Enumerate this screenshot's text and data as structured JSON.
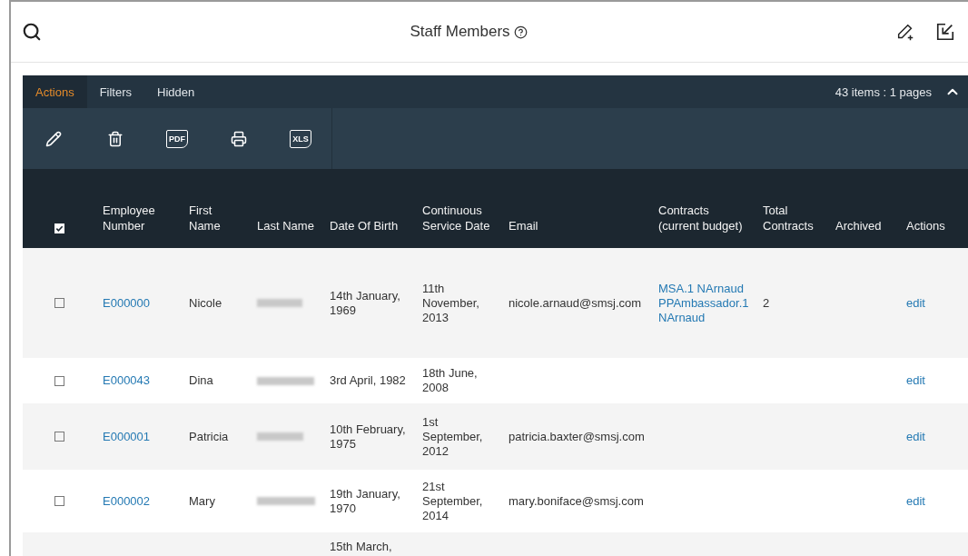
{
  "window": {
    "title": "Staff Members"
  },
  "tabs": [
    {
      "label": "Actions",
      "selected": true
    },
    {
      "label": "Filters",
      "selected": false
    },
    {
      "label": "Hidden",
      "selected": false
    }
  ],
  "pagination": {
    "summary": "43 items : 1 pages",
    "expanded": true
  },
  "toolbar": [
    {
      "kind": "edit"
    },
    {
      "kind": "delete"
    },
    {
      "kind": "file",
      "label": "PDF"
    },
    {
      "kind": "print"
    },
    {
      "kind": "file",
      "label": "XLS"
    }
  ],
  "table": {
    "select_all": {
      "checked": true
    },
    "columns": [
      "Employee Number",
      "First Name",
      "Last Name",
      "Date Of Birth",
      "Continuous Service Date",
      "Email",
      "Contracts (current budget)",
      "Total Contracts",
      "Archived",
      "Actions"
    ],
    "rows": [
      {
        "checked": false,
        "number": "E000000",
        "first_name": "Nicole",
        "last_name_redacted": true,
        "date_of_birth": "14th January, 1969",
        "service_date": "11th November, 2013",
        "email": "nicole.arnaud@smsj.com",
        "contracts": [
          "MSA.1 NArnaud",
          "PPAmbassador.1 NArnaud"
        ],
        "total_contracts": "2",
        "action": "edit"
      },
      {
        "checked": false,
        "number": "E000043",
        "first_name": "Dina",
        "last_name_redacted": true,
        "date_of_birth": "3rd April, 1982",
        "service_date": "18th June, 2008",
        "action": "edit"
      },
      {
        "checked": false,
        "number": "E000001",
        "first_name": "Patricia",
        "last_name_redacted": true,
        "date_of_birth": "10th February, 1975",
        "service_date": "1st September, 2012",
        "email": "patricia.baxter@smsj.com",
        "action": "edit"
      },
      {
        "checked": false,
        "number": "E000002",
        "first_name": "Mary",
        "last_name_redacted": true,
        "date_of_birth": "19th January, 1970",
        "service_date": "21st September, 2014",
        "email": "mary.boniface@smsj.com",
        "action": "edit"
      },
      {
        "date_of_birth": "15th March,"
      }
    ]
  }
}
